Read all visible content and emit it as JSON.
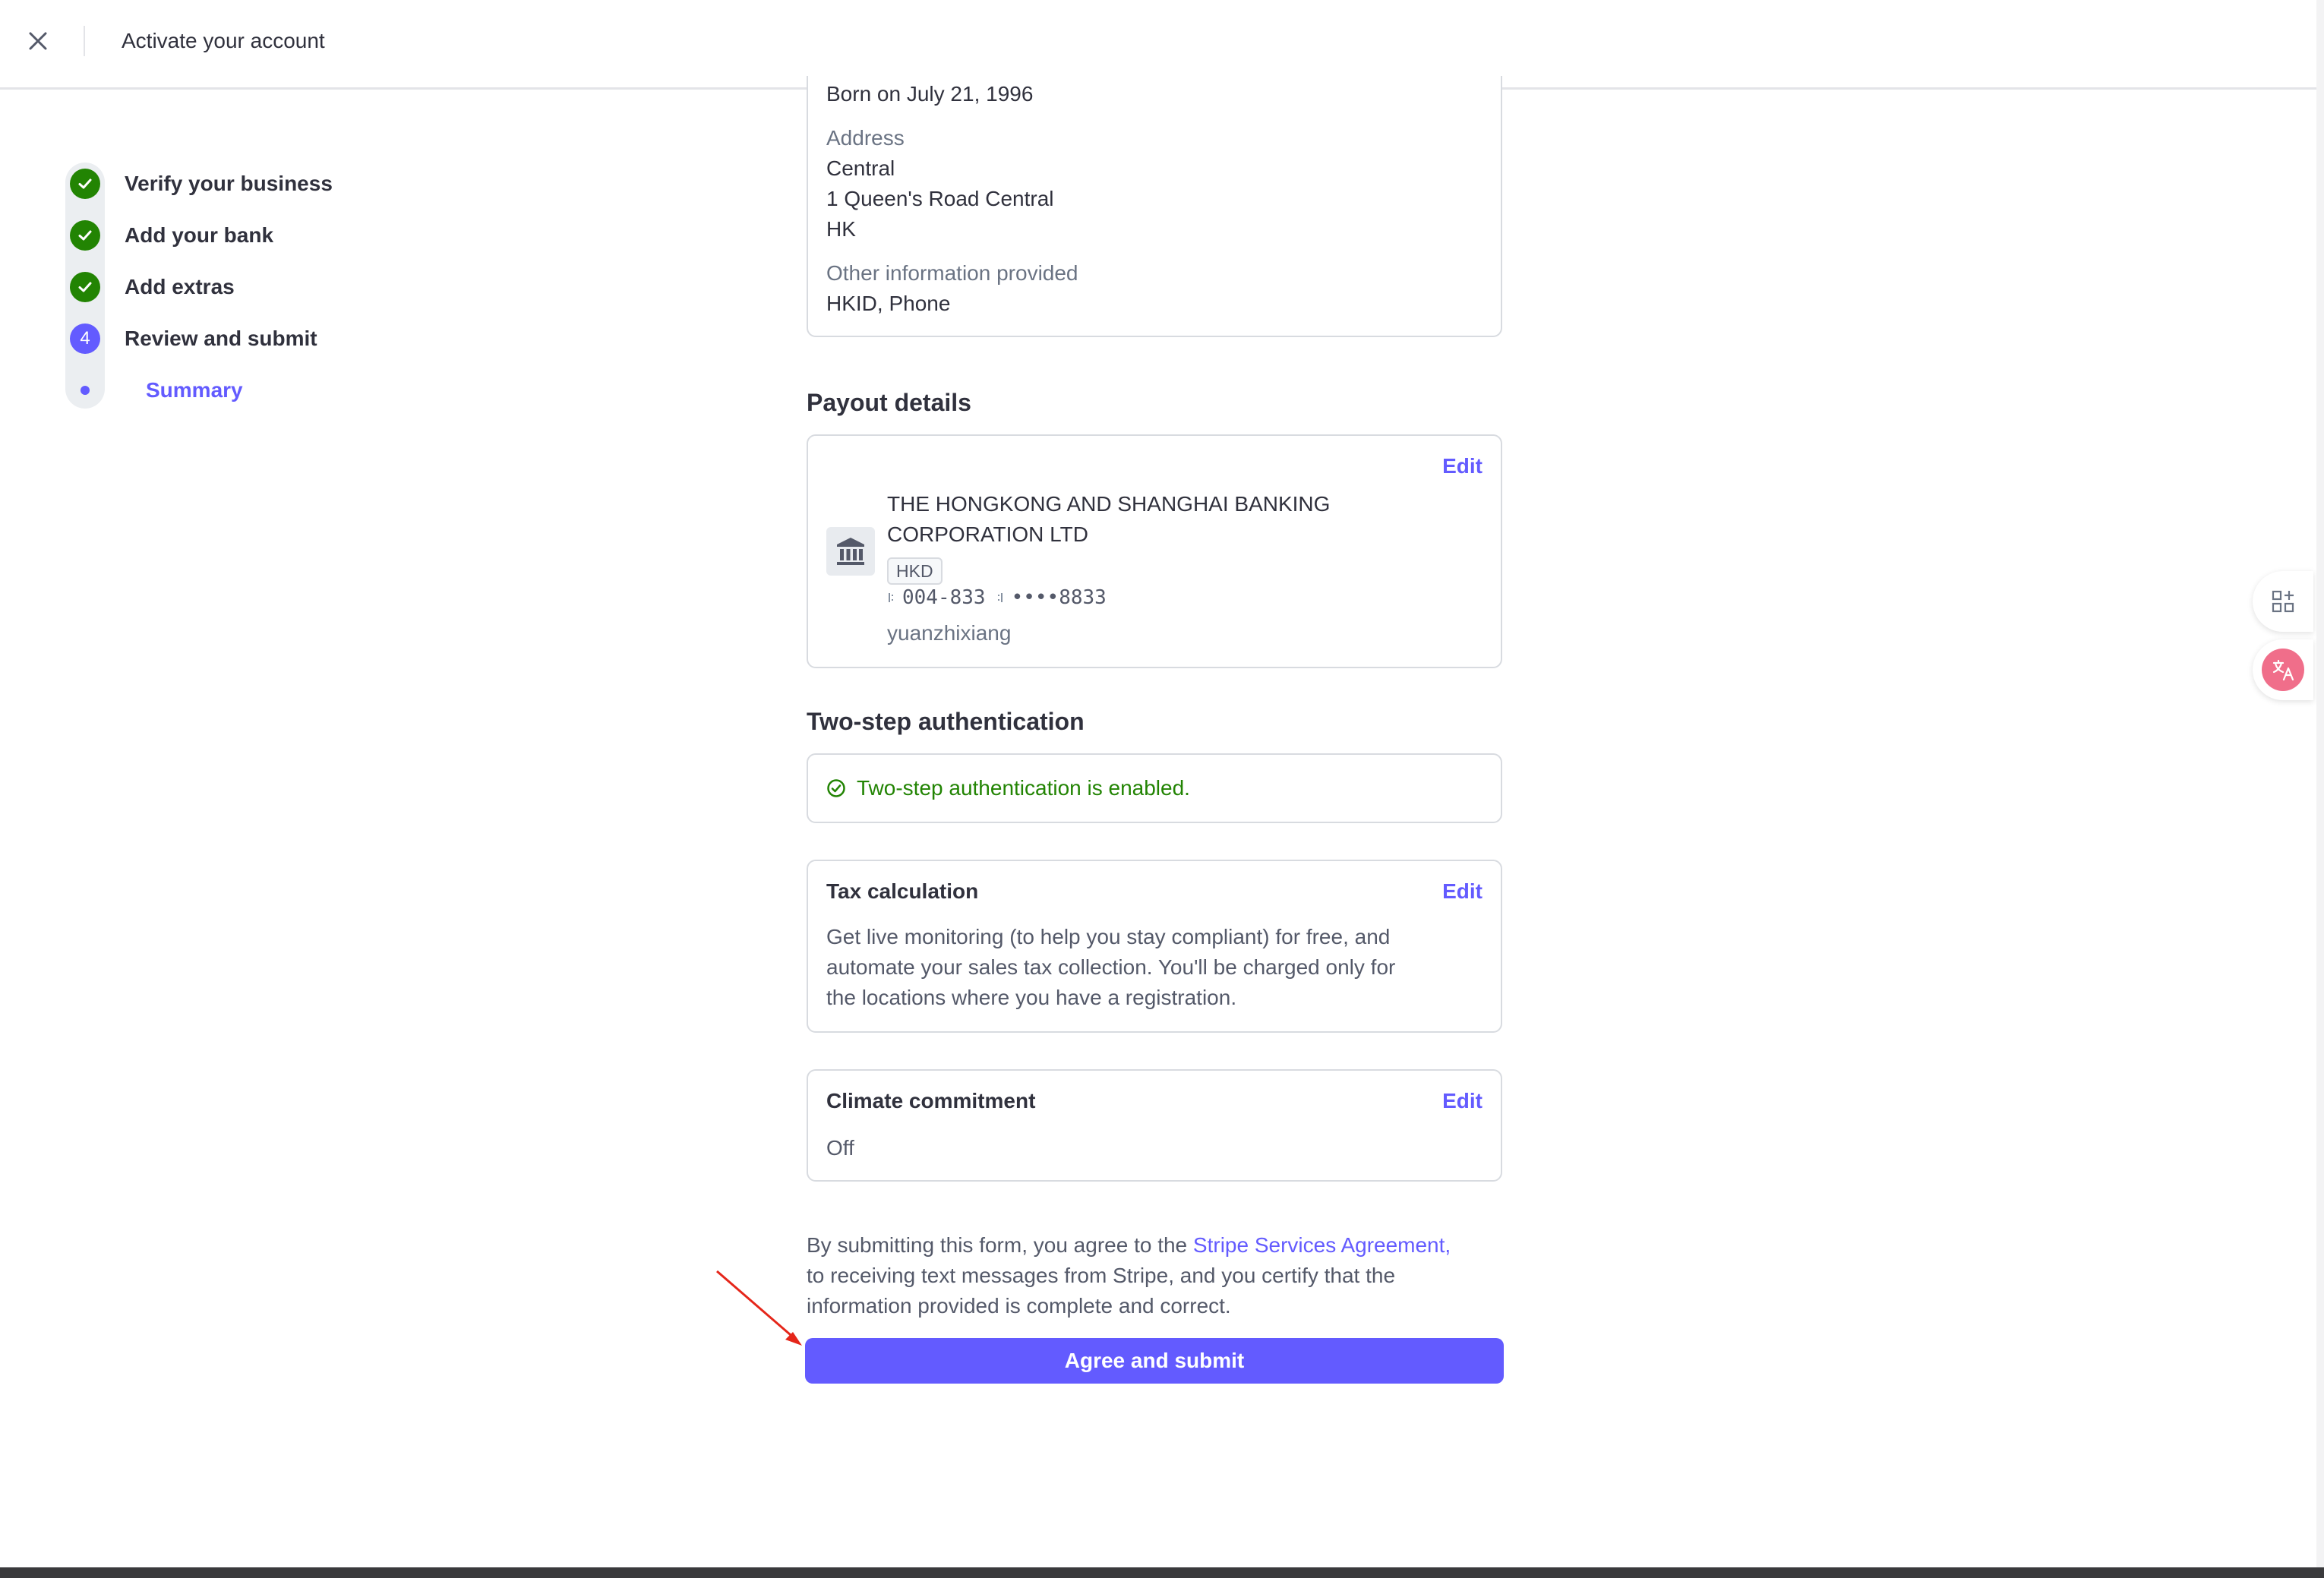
{
  "header": {
    "title": "Activate your account"
  },
  "stepper": {
    "steps": [
      {
        "label": "Verify your business",
        "status": "complete"
      },
      {
        "label": "Add your bank",
        "status": "complete"
      },
      {
        "label": "Add extras",
        "status": "complete"
      },
      {
        "label": "Review and submit",
        "status": "current",
        "number": "4"
      },
      {
        "label": "Summary",
        "status": "substep-active"
      }
    ]
  },
  "personal_card": {
    "born": "Born on July 21, 1996",
    "address_label": "Address",
    "address_lines": [
      "Central",
      "1 Queen's Road Central",
      "HK"
    ],
    "other_label": "Other information provided",
    "other_value": "HKID, Phone"
  },
  "payout": {
    "section_title": "Payout details",
    "edit_label": "Edit",
    "bank_name_line1": "THE HONGKONG AND SHANGHAI BANKING",
    "bank_name_line2": "CORPORATION LTD",
    "currency": "HKD",
    "routing": "004-833",
    "account": "••••8833",
    "holder": "yuanzhixiang"
  },
  "two_step": {
    "section_title": "Two-step authentication",
    "status_text": "Two-step authentication is enabled."
  },
  "tax": {
    "title": "Tax calculation",
    "edit_label": "Edit",
    "description_lines": [
      "Get live monitoring (to help you stay compliant) for free, and",
      "automate your sales tax collection. You'll be charged only for",
      "the locations where you have a registration."
    ]
  },
  "climate": {
    "title": "Climate commitment",
    "edit_label": "Edit",
    "value": "Off"
  },
  "legal": {
    "prefix": "By submitting this form, you agree to the ",
    "link": "Stripe Services Agreement,",
    "line2": "to receiving text messages from Stripe, and you certify that the",
    "line3": "information provided is complete and correct."
  },
  "submit": {
    "label": "Agree and submit"
  },
  "colors": {
    "brand": "#635bff",
    "success": "#228403",
    "annotation_arrow": "#e5261a"
  },
  "icons": {
    "close": "close-icon",
    "check": "check-icon",
    "bank": "bank-icon",
    "shield_check": "check-circle-icon",
    "grid_add": "grid-add-icon",
    "translate": "translate-icon"
  }
}
